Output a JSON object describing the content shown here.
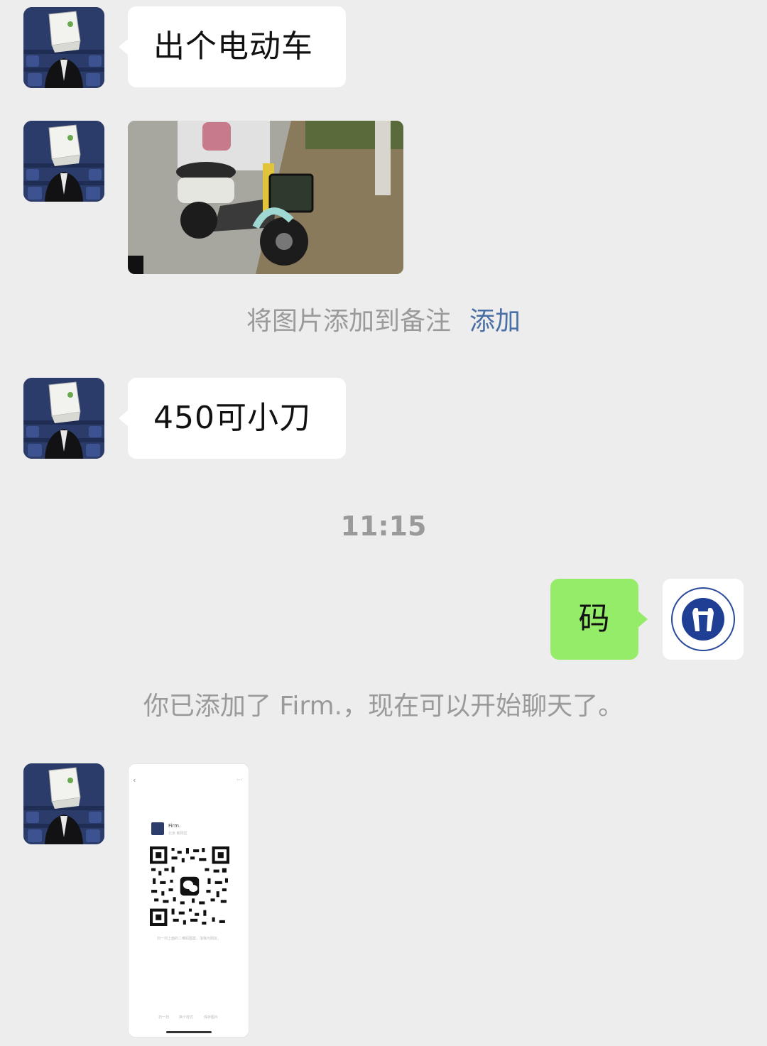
{
  "messages": {
    "m1": {
      "text": "出个电动车"
    },
    "m3": {
      "text": "450可小刀"
    },
    "m4": {
      "text": "码"
    }
  },
  "system": {
    "add_image_note": "将图片添加到备注",
    "add_link": "添加",
    "timestamp": "11:15",
    "added_notice": "你已添加了 Firm.，现在可以开始聊天了。"
  },
  "qr_card": {
    "back_glyph": "‹",
    "more_glyph": "···",
    "profile_name": "Firm.",
    "profile_region": "北京 朝阳区",
    "hint": "扫一扫上面的二维码图案，加我为朋友。",
    "actions": [
      "扫一扫",
      "换个样式",
      "保存图片"
    ]
  },
  "colors": {
    "background": "#ededed",
    "incoming_bubble": "#ffffff",
    "outgoing_bubble": "#95ec69",
    "link": "#4a6fa5",
    "system_text": "#9a9a9a"
  },
  "icons": {
    "contact_avatar": "person-paper-bag-avatar",
    "my_avatar": "blue-circle-emblem-avatar"
  }
}
